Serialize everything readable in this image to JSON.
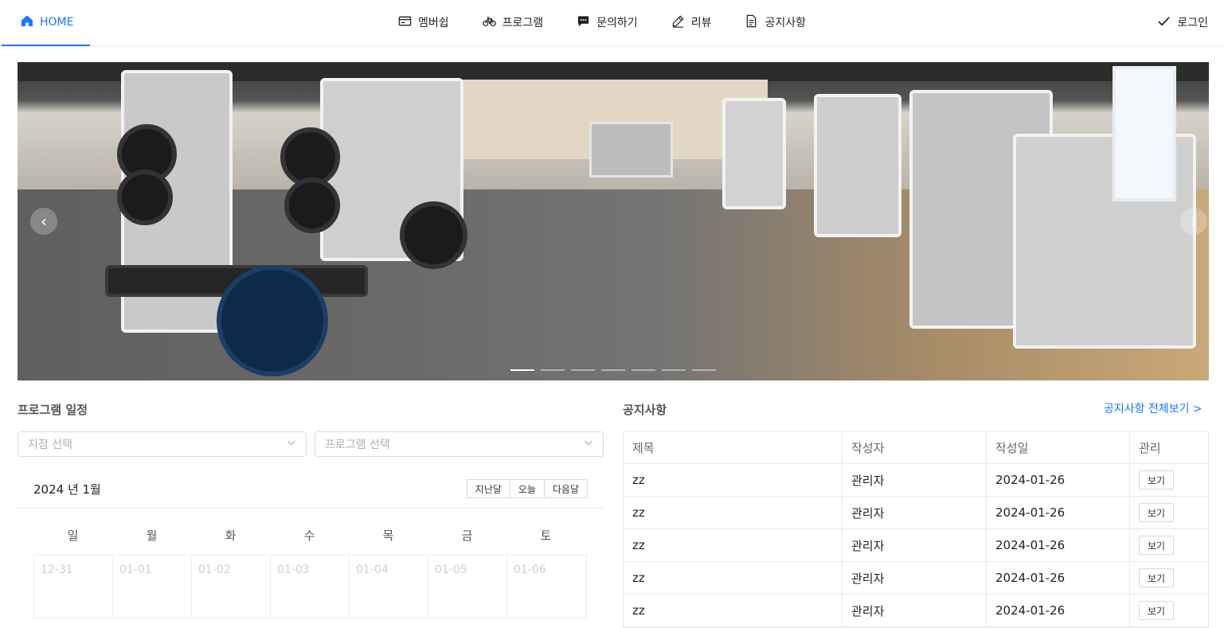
{
  "nav": {
    "home": "HOME",
    "items": [
      {
        "label": "멤버쉽",
        "icon": "card-icon"
      },
      {
        "label": "프로그램",
        "icon": "bicycle-icon"
      },
      {
        "label": "문의하기",
        "icon": "chat-icon"
      },
      {
        "label": "리뷰",
        "icon": "pencil-icon"
      },
      {
        "label": "공지사항",
        "icon": "document-icon"
      }
    ],
    "login": "로그인"
  },
  "carousel": {
    "slides": 7,
    "active": 0
  },
  "schedule": {
    "title": "프로그램 일정",
    "branch_placeholder": "지점 선택",
    "program_placeholder": "프로그램 선택",
    "month": "2024 년 1월",
    "buttons": [
      "지난달",
      "오늘",
      "다음달"
    ],
    "weekdays": [
      "일",
      "월",
      "화",
      "수",
      "목",
      "금",
      "토"
    ],
    "dates": [
      "12-31",
      "01-01",
      "01-02",
      "01-03",
      "01-04",
      "01-05",
      "01-06"
    ]
  },
  "notices": {
    "title": "공지사항",
    "view_all": "공지사항 전체보기 >",
    "columns": [
      "제목",
      "작성자",
      "작성일",
      "관리"
    ],
    "rows": [
      {
        "title": "zz",
        "author": "관리자",
        "date": "2024-01-26",
        "action": "보기"
      },
      {
        "title": "zz",
        "author": "관리자",
        "date": "2024-01-26",
        "action": "보기"
      },
      {
        "title": "zz",
        "author": "관리자",
        "date": "2024-01-26",
        "action": "보기"
      },
      {
        "title": "zz",
        "author": "관리자",
        "date": "2024-01-26",
        "action": "보기"
      },
      {
        "title": "zz",
        "author": "관리자",
        "date": "2024-01-26",
        "action": "보기"
      }
    ]
  },
  "colors": {
    "accent": "#1677ff"
  }
}
